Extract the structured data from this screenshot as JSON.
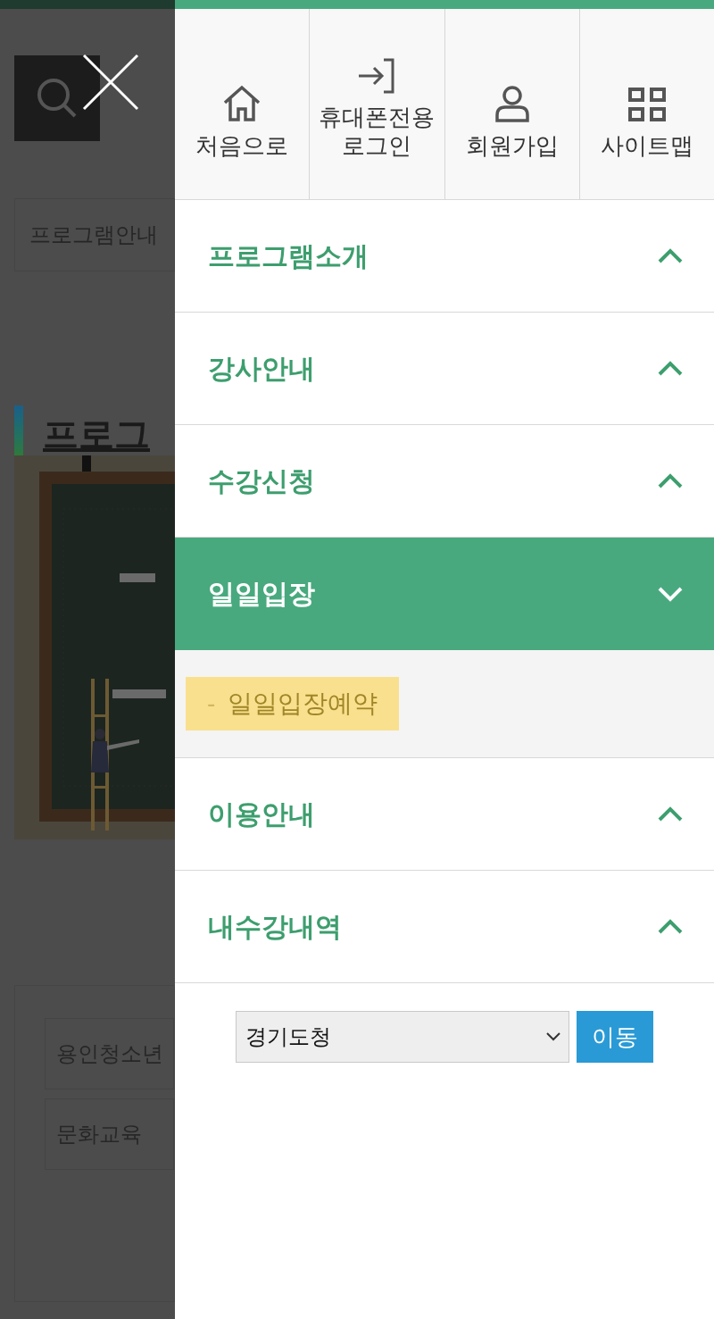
{
  "background_page": {
    "breadcrumb": "프로그램안내",
    "heading": "프로그",
    "fields": [
      "용인청소년",
      "문화교육"
    ]
  },
  "quick_links": [
    {
      "label": "처음으로",
      "kind": "home"
    },
    {
      "label": "휴대폰전용\n로그인",
      "kind": "login"
    },
    {
      "label": "회원가입",
      "kind": "user"
    },
    {
      "label": "사이트맵",
      "kind": "grid"
    }
  ],
  "menu": [
    {
      "label": "프로그램소개",
      "expanded": false
    },
    {
      "label": "강사안내",
      "expanded": false
    },
    {
      "label": "수강신청",
      "expanded": false
    },
    {
      "label": "일일입장",
      "expanded": true,
      "children": [
        {
          "bullet": "-",
          "label": "일일입장예약",
          "selected": true
        }
      ]
    },
    {
      "label": "이용안내",
      "expanded": false
    },
    {
      "label": "내수강내역",
      "expanded": false
    }
  ],
  "site_select": {
    "value": "경기도청",
    "button": "이동"
  }
}
